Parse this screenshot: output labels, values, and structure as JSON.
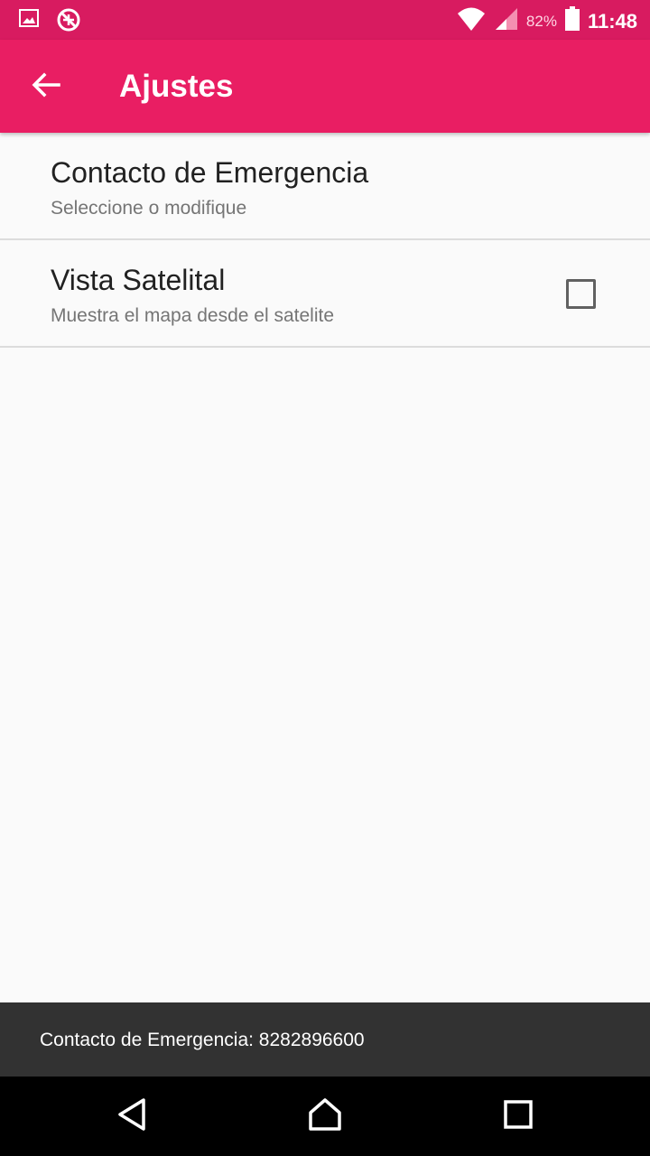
{
  "status_bar": {
    "icons_left": [
      "image-icon",
      "no-location-icon"
    ],
    "icons_right": [
      "wifi-icon",
      "signal-icon",
      "battery-icon"
    ],
    "battery_percent": "82%",
    "time": "11:48"
  },
  "app_bar": {
    "title": "Ajustes",
    "back_icon": "arrow-left-icon",
    "color": "#e91e63"
  },
  "preferences": [
    {
      "title": "Contacto de Emergencia",
      "summary": "Seleccione o modifique"
    },
    {
      "title": "Vista Satelital",
      "summary": "Muestra el mapa desde el satelite",
      "checked": false
    }
  ],
  "snackbar": {
    "text": "Contacto de Emergencia: 8282896600"
  },
  "nav_bar": {
    "buttons": [
      "back-triangle-icon",
      "home-icon",
      "recents-square-icon"
    ]
  },
  "colors": {
    "status_bar": "#d81b60",
    "primary": "#e91e63",
    "background": "#fafafa",
    "snackbar": "#323232"
  }
}
